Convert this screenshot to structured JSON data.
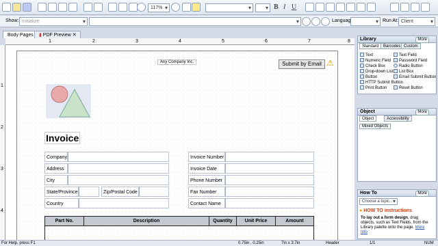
{
  "toolbar": {
    "zoom": "117%"
  },
  "bar2": {
    "show_label": "Show:",
    "show_value": "Initialize",
    "language_label": "Language:",
    "language_value": "",
    "run_at_label": "Run At:",
    "run_at_value": "Client"
  },
  "tabs": [
    {
      "label": "Body Pages"
    },
    {
      "label": "PDF Preview"
    }
  ],
  "ruler": {
    "top_ticks": [
      "1",
      "2",
      "3",
      "4",
      "5",
      "6",
      "7",
      "8"
    ],
    "left_ticks": [
      "1",
      "2",
      "3",
      "4"
    ]
  },
  "form": {
    "company": "Any Company Inc.",
    "submit": "Submit by Email",
    "title": "Invoice",
    "left_fields": [
      "Company",
      "Address",
      "City",
      "State/Province",
      "Country"
    ],
    "zip": "Zip/Postal Code",
    "right_fields": [
      "Invoice Number",
      "Invoice Date",
      "Phone Number",
      "Fax Number",
      "Contact Name"
    ],
    "table_headers": [
      "Part No.",
      "Description",
      "Quantity",
      "Unit Price",
      "Amount"
    ]
  },
  "library": {
    "title": "Library",
    "more": "More",
    "tabs": [
      "Standard",
      "Barcodes",
      "Custom"
    ],
    "items": [
      [
        "Text",
        "Text Field"
      ],
      [
        "Numeric Field",
        "Password Field"
      ],
      [
        "Check Box",
        "Radio Button"
      ],
      [
        "Drop-down List",
        "List Box"
      ],
      [
        "Button",
        "Email Submit Button"
      ],
      [
        "HTTP Submit Button",
        ""
      ],
      [
        "Print Button",
        "Reset Button"
      ]
    ]
  },
  "object": {
    "title": "Object",
    "more": "More",
    "tabs": [
      "Object",
      "Accessibility"
    ],
    "content": "Mixed Objects"
  },
  "howto": {
    "title": "How To",
    "more": "More",
    "select": "Choose a topic...",
    "heading": "HOW TO instructions",
    "body_bold": "To lay out a form design",
    "body": ", drag objects, such as Text Fields, from the Library palette onto the page.",
    "more_info": "More Info"
  },
  "status": {
    "help": "For Help, press F1",
    "position": "0.75in , 0.25in",
    "size": "7in x 3.7in",
    "section": "Header",
    "page": "1/1",
    "num": "NUM"
  }
}
